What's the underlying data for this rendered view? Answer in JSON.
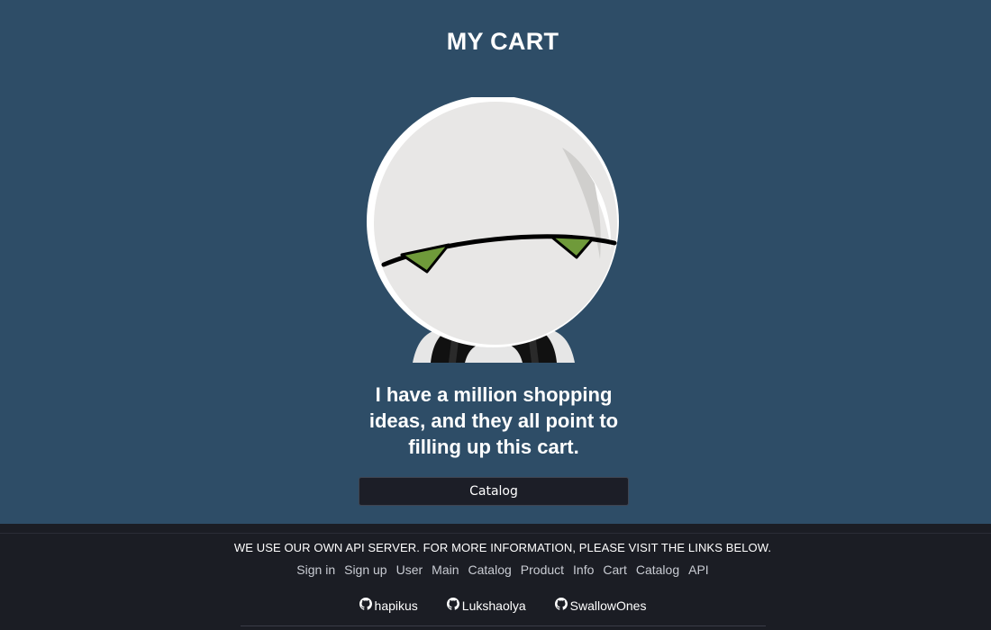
{
  "page": {
    "title": "MY CART",
    "message": "I have a million shopping ideas, and they all point to filling up this cart.",
    "button_label": "Catalog"
  },
  "footer": {
    "notice": "WE USE OUR OWN API SERVER. FOR MORE INFORMATION, PLEASE VISIT THE LINKS BELOW.",
    "nav": [
      "Sign in",
      "Sign up",
      "User",
      "Main",
      "Catalog",
      "Product",
      "Info",
      "Cart",
      "Catalog",
      "API"
    ],
    "authors": [
      {
        "name": "hapikus",
        "icon": "github-icon"
      },
      {
        "name": "Lukshaolya",
        "icon": "github-icon"
      },
      {
        "name": "SwallowOnes",
        "icon": "github-icon"
      }
    ]
  },
  "colors": {
    "background": "#2e4d67",
    "footer_background": "#1b1d24",
    "button_background": "#1c1e27",
    "eye_green": "#6f9a3a"
  },
  "illustration": {
    "icon": "sad-robot-illustration"
  }
}
